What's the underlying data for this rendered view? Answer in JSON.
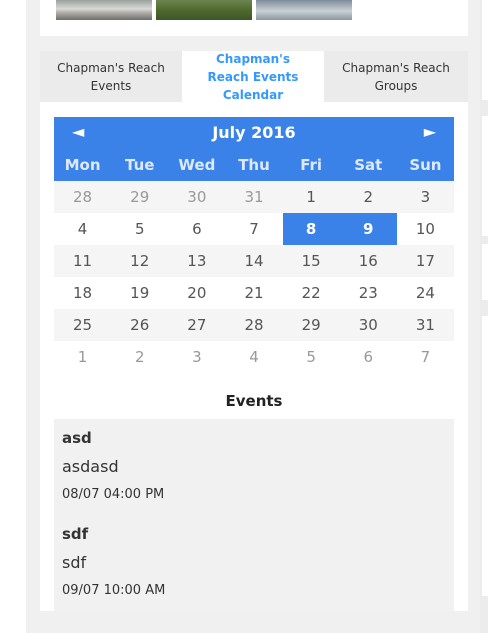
{
  "tabs": [
    {
      "label": "Chapman's Reach Events",
      "active": false
    },
    {
      "label": "Chapman's Reach Events Calendar",
      "active": true
    },
    {
      "label": "Chapman's Reach Groups",
      "active": false
    }
  ],
  "calendar": {
    "prev_label": "◄",
    "next_label": "►",
    "title": "July 2016",
    "weekdays": [
      "Mon",
      "Tue",
      "Wed",
      "Thu",
      "Fri",
      "Sat",
      "Sun"
    ],
    "weeks": [
      [
        {
          "d": "28",
          "t": "other"
        },
        {
          "d": "29",
          "t": "other"
        },
        {
          "d": "30",
          "t": "other"
        },
        {
          "d": "31",
          "t": "other"
        },
        {
          "d": "1",
          "t": "cur"
        },
        {
          "d": "2",
          "t": "cur"
        },
        {
          "d": "3",
          "t": "cur"
        }
      ],
      [
        {
          "d": "4",
          "t": "cur"
        },
        {
          "d": "5",
          "t": "cur"
        },
        {
          "d": "6",
          "t": "cur"
        },
        {
          "d": "7",
          "t": "cur"
        },
        {
          "d": "8",
          "t": "evt"
        },
        {
          "d": "9",
          "t": "evt"
        },
        {
          "d": "10",
          "t": "cur"
        }
      ],
      [
        {
          "d": "11",
          "t": "cur"
        },
        {
          "d": "12",
          "t": "cur"
        },
        {
          "d": "13",
          "t": "cur"
        },
        {
          "d": "14",
          "t": "cur"
        },
        {
          "d": "15",
          "t": "cur"
        },
        {
          "d": "16",
          "t": "cur"
        },
        {
          "d": "17",
          "t": "cur"
        }
      ],
      [
        {
          "d": "18",
          "t": "cur"
        },
        {
          "d": "19",
          "t": "cur"
        },
        {
          "d": "20",
          "t": "cur"
        },
        {
          "d": "21",
          "t": "cur"
        },
        {
          "d": "22",
          "t": "cur"
        },
        {
          "d": "23",
          "t": "cur"
        },
        {
          "d": "24",
          "t": "cur"
        }
      ],
      [
        {
          "d": "25",
          "t": "cur"
        },
        {
          "d": "26",
          "t": "cur"
        },
        {
          "d": "27",
          "t": "cur"
        },
        {
          "d": "28",
          "t": "cur"
        },
        {
          "d": "29",
          "t": "cur"
        },
        {
          "d": "30",
          "t": "cur"
        },
        {
          "d": "31",
          "t": "cur"
        }
      ],
      [
        {
          "d": "1",
          "t": "other"
        },
        {
          "d": "2",
          "t": "other"
        },
        {
          "d": "3",
          "t": "other"
        },
        {
          "d": "4",
          "t": "other"
        },
        {
          "d": "5",
          "t": "other"
        },
        {
          "d": "6",
          "t": "other"
        },
        {
          "d": "7",
          "t": "other"
        }
      ]
    ]
  },
  "events": {
    "heading": "Events",
    "items": [
      {
        "name": "asd",
        "description": "asdasd",
        "time": "08/07 04:00 PM"
      },
      {
        "name": "sdf",
        "description": "sdf",
        "time": "09/07 10:00 AM"
      }
    ]
  },
  "colors": {
    "accent": "#3b82e8",
    "active_tab_text": "#3399ff"
  }
}
